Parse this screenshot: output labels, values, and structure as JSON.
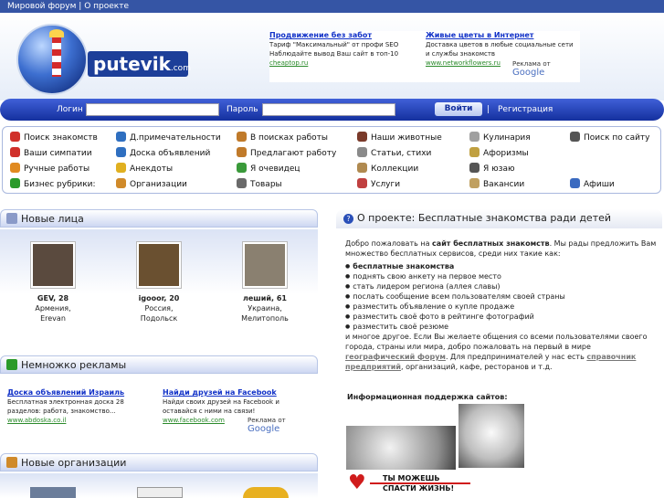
{
  "topbar": {
    "links": [
      "Мировой форум",
      "|",
      "О проекте"
    ]
  },
  "logo": {
    "name": "putevik",
    "suffix": ".com"
  },
  "top_ads": {
    "items": [
      {
        "title": "Продвижение без забот",
        "text": "Тариф \"Максимальный\" от профи SEO Наблюдайте вывод Ваш сайт в топ-10",
        "url": "cheaptop.ru"
      },
      {
        "title": "Живые цветы в Интернет",
        "text": "Доставка цветов в любые социальные сети и службы знакомств",
        "url": "www.networkflowers.ru"
      }
    ],
    "credit_prefix": "Реклама от",
    "credit_brand": "Google"
  },
  "login": {
    "login_label": "Логин",
    "password_label": "Пароль",
    "submit": "Войти",
    "separator": "|",
    "register": "Регистрация"
  },
  "menu": {
    "items": [
      {
        "label": "Поиск знакомств",
        "icon": "heart-icon",
        "color": "#d0302a"
      },
      {
        "label": "Д.примечательности",
        "icon": "globe-icon",
        "color": "#2f6fc0"
      },
      {
        "label": "В поисках работы",
        "icon": "worker-icon",
        "color": "#c07a2a"
      },
      {
        "label": "Наши животные",
        "icon": "pet-icon",
        "color": "#7a3a2a"
      },
      {
        "label": "Кулинария",
        "icon": "chef-icon",
        "color": "#a0a0a0"
      },
      {
        "label": "Поиск по сайту",
        "icon": "search-icon",
        "color": "#555555"
      },
      {
        "label": "Ваши симпатии",
        "icon": "hearts-icon",
        "color": "#d0302a"
      },
      {
        "label": "Доска объявлений",
        "icon": "globe-icon",
        "color": "#2f6fc0"
      },
      {
        "label": "Предлагают работу",
        "icon": "worker-icon",
        "color": "#c07a2a"
      },
      {
        "label": "Статьи, стихи",
        "icon": "document-icon",
        "color": "#8a8a8a"
      },
      {
        "label": "Афоризмы",
        "icon": "quote-icon",
        "color": "#c0a040"
      },
      {
        "label": "Ручные работы",
        "icon": "flower-icon",
        "color": "#e08a20"
      },
      {
        "label": "Анекдоты",
        "icon": "smile-icon",
        "color": "#e0b020"
      },
      {
        "label": "Я очевидец",
        "icon": "witness-icon",
        "color": "#3a9a3a"
      },
      {
        "label": "Коллекции",
        "icon": "collection-icon",
        "color": "#b08a50"
      },
      {
        "label": "Я юзаю",
        "icon": "camera-icon",
        "color": "#555555"
      },
      {
        "label": "Бизнес рубрики:",
        "icon": "dollar-icon",
        "color": "#2a9a2a"
      },
      {
        "label": "Организации",
        "icon": "building-icon",
        "color": "#d08a2a"
      },
      {
        "label": "Товары",
        "icon": "goods-icon",
        "color": "#6a6a6a"
      },
      {
        "label": "Услуги",
        "icon": "services-icon",
        "color": "#c04040"
      },
      {
        "label": "Вакансии",
        "icon": "vacancy-icon",
        "color": "#c0a060"
      },
      {
        "label": "Афиши",
        "icon": "poster-icon",
        "color": "#3a6ac0"
      }
    ]
  },
  "new_faces": {
    "title": "Новые лица",
    "people": [
      {
        "name": "GEV, 28",
        "country": "Армения,",
        "city": "Erevan",
        "photo_color": "#5a4a3e"
      },
      {
        "name": "igooor, 20",
        "country": "Россия,",
        "city": "Подольск",
        "photo_color": "#6a5030"
      },
      {
        "name": "леший, 61",
        "country": "Украина,",
        "city": "Мелитополь",
        "photo_color": "#8a8070"
      }
    ]
  },
  "ads_section": {
    "title": "Немножко рекламы",
    "items": [
      {
        "title": "Доска объявлений Израиль",
        "text": "Бесплатная электронная доска 28 разделов: работа, знакомство...",
        "url": "www.abdoska.co.il"
      },
      {
        "title": "Найди друзей на Facebook",
        "text": "Найди своих друзей на Facebook и оставайся с ними на связи!",
        "url": "www.facebook.com"
      }
    ],
    "credit_prefix": "Реклама от",
    "credit_brand": "Google"
  },
  "orgs": {
    "title": "Новые организации"
  },
  "about": {
    "title": "О проекте: Бесплатные знакомства ради детей",
    "intro_1": "Добро пожаловать на ",
    "intro_bold": "сайт бесплатных знакомств",
    "intro_2": ". Мы рады предложить Вам множество бесплатных сервисов, среди них такие как:",
    "list": [
      "бесплатные знакомства",
      "поднять свою анкету на первое место",
      "стать лидером региона (аллея славы)",
      "послать сообщение всем пользователям своей страны",
      "разместить объявление о купле продаже",
      "разместить своё фото в рейтинге фотографий",
      "разместить своё резюме"
    ],
    "outro_1": "и многое другое. Если Вы желаете общения со всеми пользователями своего города, страны или мира, добро пожаловать на первый в мире ",
    "forum_link": "географический форум",
    "outro_2": ". Для предпринимателей у нас есть ",
    "directory_link": "справочник предприятий",
    "outro_3": ", организаций, кафе, ресторанов и т.д.",
    "support_title": "Информационная поддержка сайтов:",
    "banner_text_1": "ТЫ МОЖЕШЬ",
    "banner_text_2": "СПАСТИ ЖИЗНЬ!"
  }
}
